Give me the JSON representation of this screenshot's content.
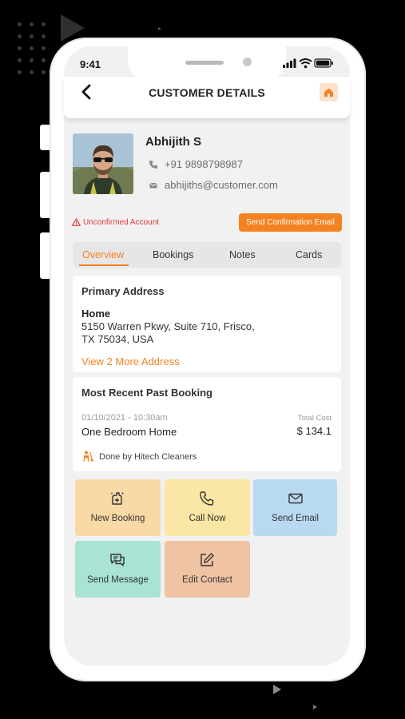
{
  "status_bar": {
    "time": "9:41"
  },
  "header": {
    "title": "CUSTOMER DETAILS"
  },
  "customer": {
    "name": "Abhijith S",
    "phone": "+91 9898798987",
    "email": "abhijiths@customer.com"
  },
  "account": {
    "status_text": "Unconfirmed Account",
    "send_confirmation_label": "Send Confirmation Email"
  },
  "tabs": [
    {
      "label": "Overview",
      "active": true
    },
    {
      "label": "Bookings",
      "active": false
    },
    {
      "label": "Notes",
      "active": false
    },
    {
      "label": "Cards",
      "active": false
    }
  ],
  "address": {
    "heading": "Primary Address",
    "label": "Home",
    "line1": "5150 Warren Pkwy, Suite 710, Frisco,",
    "line2": "TX 75034, USA",
    "more_link": "View 2 More Address"
  },
  "recent_booking": {
    "heading": "Most Recent Past Booking",
    "datetime": "01/10/2021 - 10:30am",
    "total_label": "Total Cost",
    "service": "One Bedroom Home",
    "amount": "$ 134.1",
    "done_by": "Done by Hitech Cleaners"
  },
  "actions": [
    {
      "label": "New Booking",
      "icon": "new-booking-icon",
      "color": "#f9d9a6"
    },
    {
      "label": "Call Now",
      "icon": "phone-icon",
      "color": "#fbe7a5"
    },
    {
      "label": "Send Email",
      "icon": "mail-icon",
      "color": "#b9d9f0"
    },
    {
      "label": "Send Message",
      "icon": "message-icon",
      "color": "#a8e3d6"
    },
    {
      "label": "Edit Contact",
      "icon": "edit-icon",
      "color": "#f0c3a3"
    }
  ],
  "colors": {
    "accent": "#f58220",
    "warning": "#e5383b",
    "background": "#000000",
    "screen": "#f1f1f1"
  }
}
